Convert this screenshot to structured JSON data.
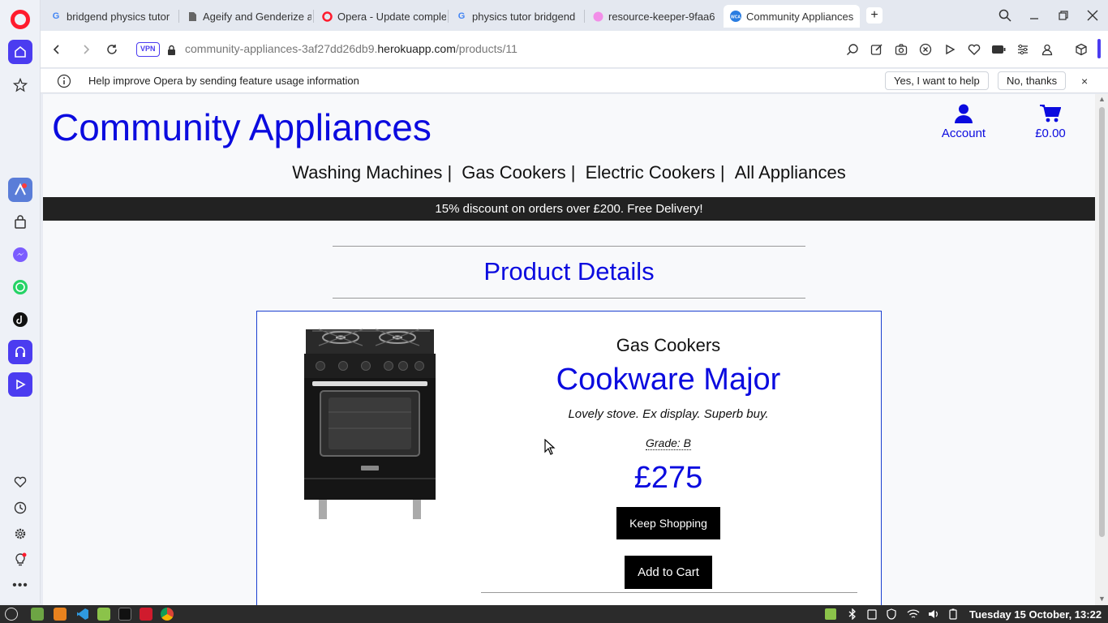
{
  "browser": {
    "tabs": [
      {
        "label": "bridgend physics tutor",
        "favicon": "google-icon"
      },
      {
        "label": "Ageify and Genderize a",
        "favicon": "document-icon"
      },
      {
        "label": "Opera - Update comple",
        "favicon": "opera-icon"
      },
      {
        "label": "physics tutor bridgend",
        "favicon": "google-icon"
      },
      {
        "label": "resource-keeper-9faa6",
        "favicon": "heroku-icon"
      },
      {
        "label": "Community Appliances",
        "favicon": "site-favicon",
        "active": true
      }
    ],
    "vpn_label": "VPN",
    "url_prefix": "community-appliances-3af27dd26db9.",
    "url_host": "herokuapp.com",
    "url_path": "/products/11"
  },
  "infobar": {
    "message": "Help improve Opera by sending feature usage information",
    "yes_label": "Yes, I want to help",
    "no_label": "No, thanks",
    "close": "×"
  },
  "site": {
    "brand": "Community Appliances",
    "account_label": "Account",
    "cart_total": "£0.00",
    "nav": [
      "Washing Machines |",
      "Gas Cookers |",
      "Electric Cookers |",
      "All Appliances"
    ],
    "banner": "15% discount on orders over £200. Free Delivery!",
    "page_title": "Product Details"
  },
  "product": {
    "category": "Gas Cookers",
    "name": "Cookware Major",
    "description": "Lovely stove. Ex display. Superb buy.",
    "grade": "Grade: B",
    "price": "£275",
    "keep_shopping_label": "Keep Shopping",
    "add_to_cart_label": "Add to Cart"
  },
  "taskbar": {
    "clock": "Tuesday 15 October, 13:22"
  },
  "colors": {
    "brand_blue": "#0b0bdf",
    "opera_red": "#ff1b2d",
    "opera_accent": "#4b3cf0"
  }
}
